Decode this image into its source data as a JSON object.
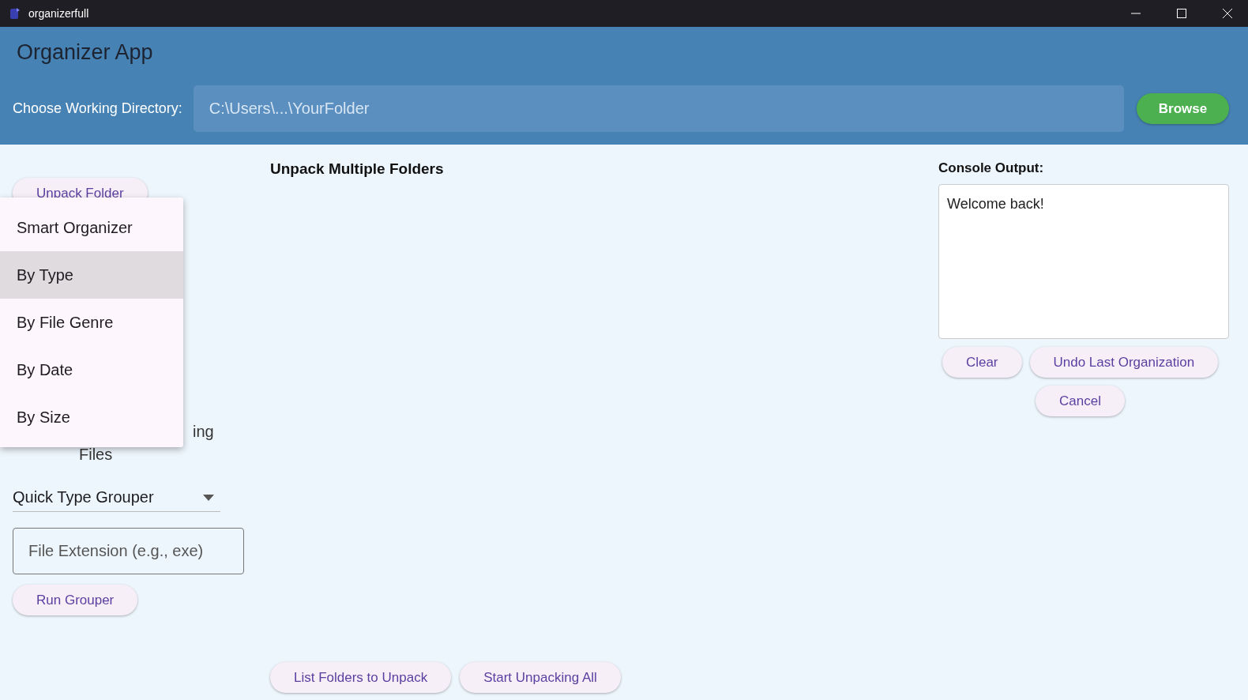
{
  "window": {
    "title": "organizerfull"
  },
  "header": {
    "title": "Organizer App",
    "directory_label": "Choose Working Directory:",
    "directory_field": {
      "placeholder": "C:\\Users\\...\\YourFolder"
    },
    "browse_button": "Browse"
  },
  "left_panel": {
    "unpack_button": "Unpack Folder",
    "partly_hidden_text": [
      "ing",
      "Files"
    ],
    "grouper_dropdown": {
      "value": "Quick Type Grouper"
    },
    "extension_field": {
      "placeholder": "File Extension (e.g., exe)"
    },
    "run_button": "Run Grouper"
  },
  "dropdown_menu": {
    "items": [
      {
        "label": "Smart Organizer",
        "selected": false
      },
      {
        "label": "By Type",
        "selected": true
      },
      {
        "label": "By File Genre",
        "selected": false
      },
      {
        "label": "By Date",
        "selected": false
      },
      {
        "label": "By Size",
        "selected": false
      }
    ]
  },
  "main": {
    "heading": "Unpack Multiple Folders",
    "buttons": [
      "List Folders to Unpack",
      "Start Unpacking All"
    ]
  },
  "console": {
    "label": "Console Output:",
    "text": "Welcome back!",
    "buttons": [
      "Clear",
      "Undo Last Organization",
      "Cancel"
    ]
  }
}
